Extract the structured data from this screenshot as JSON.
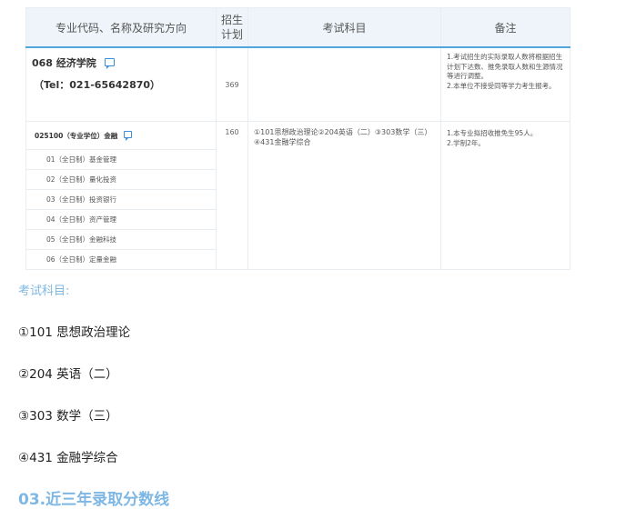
{
  "table": {
    "headers": {
      "col1": "专业代码、名称及研究方向",
      "col2_line1": "招生",
      "col2_line2": "计划",
      "col3": "考试科目",
      "col4": "备注"
    },
    "dept": {
      "name": "068 经济学院",
      "tel": "（Tel：021-65642870）",
      "plan": "369",
      "notes": [
        "1.考试招生的实际录取人数将根据招生计划下达数、推免录取人数和生源情况等进行调整。",
        "2.本单位不接受同等学力考生报考。"
      ]
    },
    "major": {
      "name": "025100（专业学位）金融",
      "plan": "160",
      "subjects_line1": "①101思想政治理论②204英语（二）③303数学（三）",
      "subjects_line2": "④431金融学综合",
      "notes": [
        "1.本专业拟招收推免生95人。",
        "2.学制2年。"
      ],
      "directions": [
        "01（全日制）基金管理",
        "02（全日制）量化投资",
        "03（全日制）投资银行",
        "04（全日制）资产管理",
        "05（全日制）金融科技",
        "06（全日制）定量金融"
      ]
    }
  },
  "exam": {
    "label": "考试科目:",
    "items": [
      "①101 思想政治理论",
      "②204 英语（二）",
      "③303 数学（三）",
      "④431 金融学综合"
    ]
  },
  "section_title": "03.近三年录取分数线",
  "colors": {
    "accent": "#4ea6dd",
    "heading": "#7eb7e3",
    "header_bg": "#eef4fa"
  },
  "icons": {
    "chat": "chat-bubble-icon"
  }
}
